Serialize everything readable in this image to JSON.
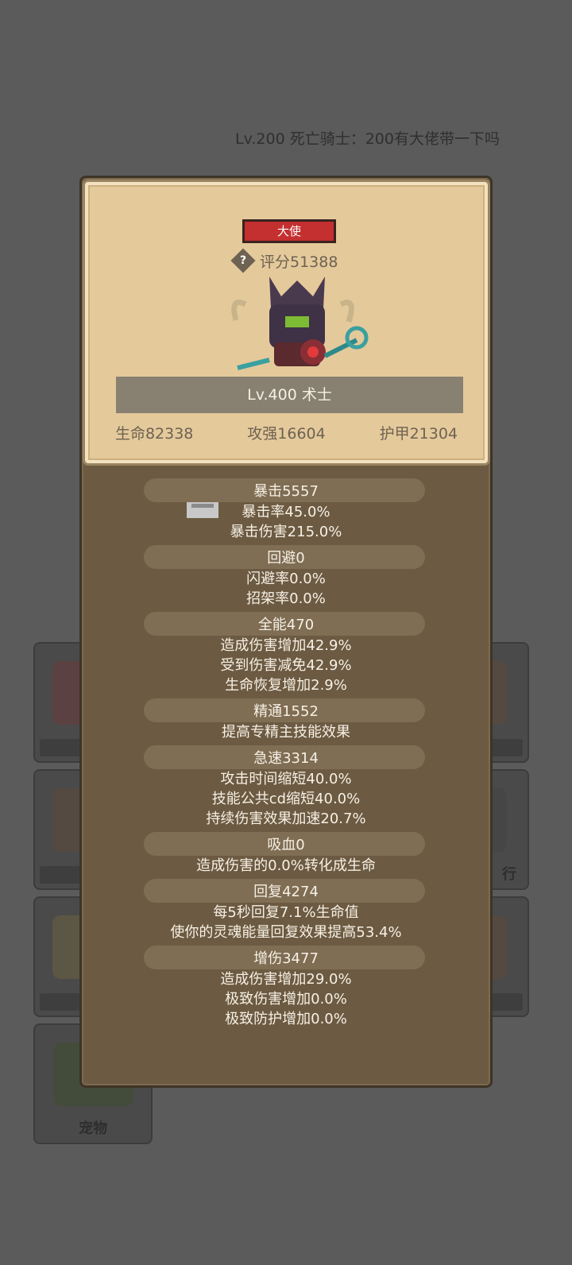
{
  "chat": {
    "message": "Lv.200 死亡骑士：200有大佬带一下吗"
  },
  "background_slots": [
    {
      "label": ""
    },
    {
      "label": ""
    },
    {
      "label": ""
    },
    {
      "label": ""
    },
    {
      "label": ""
    },
    {
      "label": "行"
    },
    {
      "label": ""
    },
    {
      "label": "宠物"
    }
  ],
  "card": {
    "title_badge": "大使",
    "score": "评分51388",
    "help_icon": "?",
    "name": "Lv.400 术士",
    "stats": {
      "hp": "生命82338",
      "attack": "攻强16604",
      "armor": "护甲21304"
    }
  },
  "attributes": [
    {
      "header": "暴击5557",
      "lines": [
        "暴击率45.0%",
        "暴击伤害215.0%"
      ]
    },
    {
      "header": "回避0",
      "lines": [
        "闪避率0.0%",
        "招架率0.0%"
      ]
    },
    {
      "header": "全能470",
      "lines": [
        "造成伤害增加42.9%",
        "受到伤害减免42.9%",
        "生命恢复增加2.9%"
      ]
    },
    {
      "header": "精通1552",
      "lines": [
        "提高专精主技能效果"
      ]
    },
    {
      "header": "急速3314",
      "lines": [
        "攻击时间缩短40.0%",
        "技能公共cd缩短40.0%",
        "持续伤害效果加速20.7%"
      ]
    },
    {
      "header": "吸血0",
      "lines": [
        "造成伤害的0.0%转化成生命"
      ]
    },
    {
      "header": "回复4274",
      "lines": [
        "每5秒回复7.1%生命值",
        "使你的灵魂能量回复效果提高53.4%"
      ]
    },
    {
      "header": "增伤3477",
      "lines": [
        "造成伤害增加29.0%",
        "极致伤害增加0.0%",
        "极致防护增加0.0%"
      ]
    }
  ],
  "colors": {
    "badge": "#c42f2f",
    "card_bg": "#e4c99b",
    "panel_bg": "#6c5a42"
  }
}
